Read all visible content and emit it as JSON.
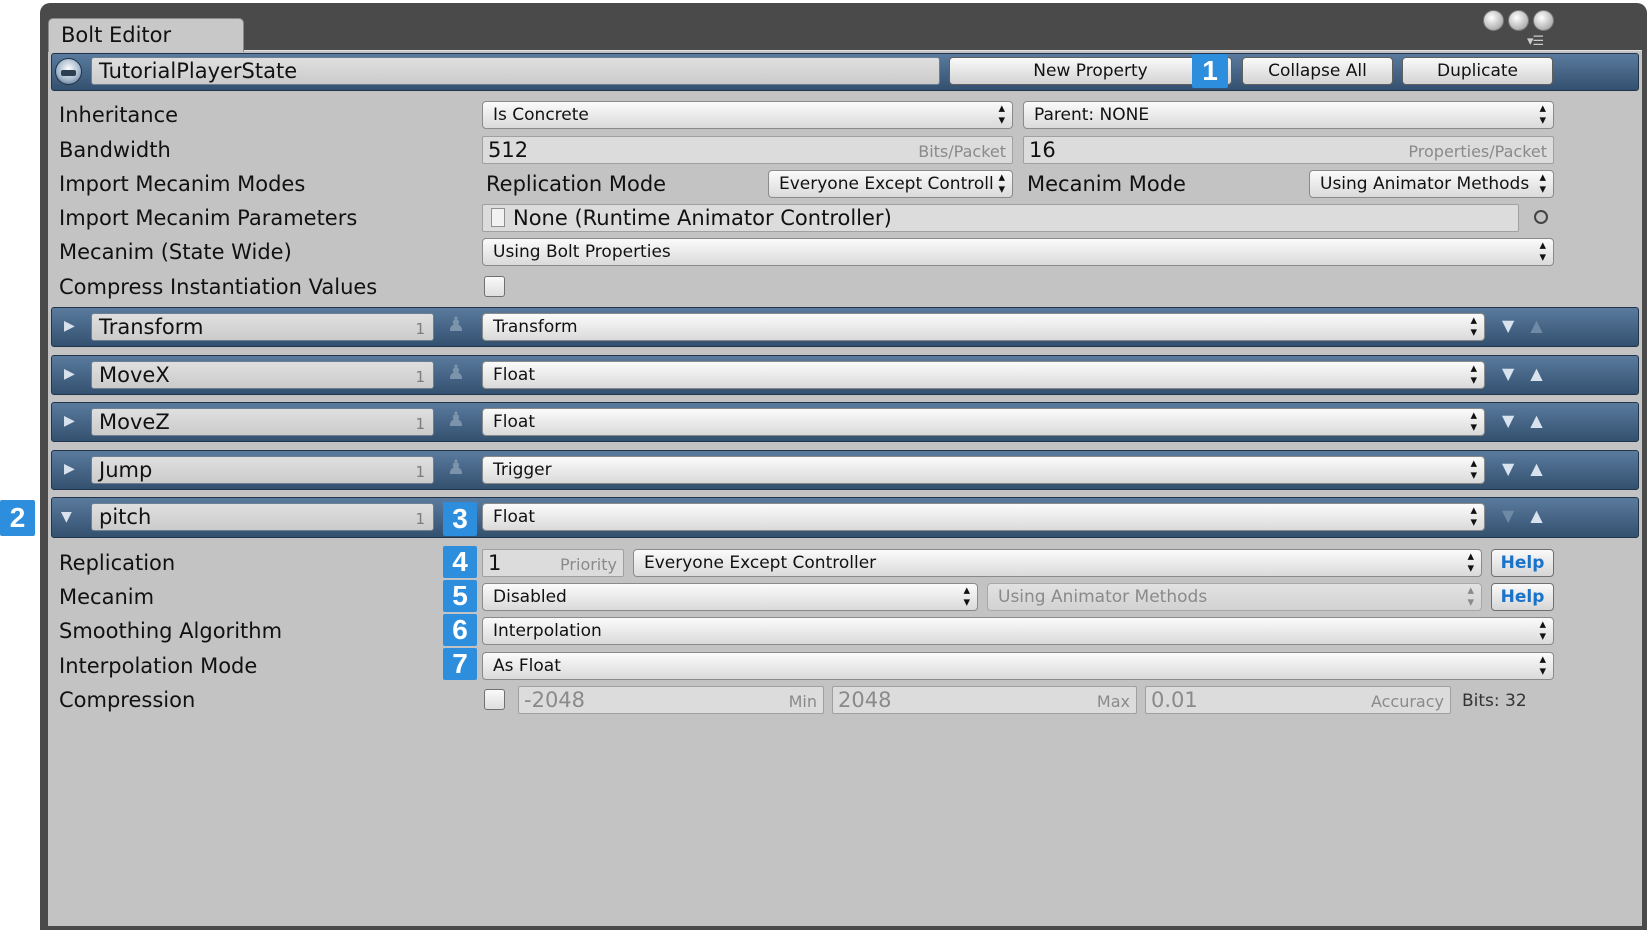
{
  "window": {
    "title": "Bolt Editor"
  },
  "header": {
    "state_name": "TutorialPlayerState",
    "new_property_label": "New Property",
    "collapse_all_label": "Collapse All",
    "duplicate_label": "Duplicate"
  },
  "settings": {
    "inheritance": {
      "label": "Inheritance",
      "type_value": "Is Concrete",
      "parent_value": "Parent: NONE"
    },
    "bandwidth": {
      "label": "Bandwidth",
      "bits_value": "512",
      "bits_unit": "Bits/Packet",
      "props_value": "16",
      "props_unit": "Properties/Packet"
    },
    "import_modes": {
      "label": "Import Mecanim Modes",
      "replication_label": "Replication Mode",
      "replication_value": "Everyone Except Controll",
      "mecanim_label": "Mecanim Mode",
      "mecanim_value": "Using Animator Methods"
    },
    "import_params": {
      "label": "Import Mecanim Parameters",
      "value": "None (Runtime Animator Controller)"
    },
    "state_wide": {
      "label": "Mecanim (State Wide)",
      "value": "Using Bolt Properties"
    },
    "compress": {
      "label": "Compress Instantiation Values"
    }
  },
  "properties": [
    {
      "name": "Transform",
      "count": "1",
      "type": "Transform",
      "expanded": false
    },
    {
      "name": "MoveX",
      "count": "1",
      "type": "Float",
      "expanded": false
    },
    {
      "name": "MoveZ",
      "count": "1",
      "type": "Float",
      "expanded": false
    },
    {
      "name": "Jump",
      "count": "1",
      "type": "Trigger",
      "expanded": false
    },
    {
      "name": "pitch",
      "count": "1",
      "type": "Float",
      "expanded": true
    }
  ],
  "detail": {
    "replication": {
      "label": "Replication",
      "priority_value": "1",
      "priority_unit": "Priority",
      "mode": "Everyone Except Controller",
      "help": "Help"
    },
    "mecanim": {
      "label": "Mecanim",
      "value": "Disabled",
      "method": "Using Animator Methods",
      "help": "Help"
    },
    "smoothing": {
      "label": "Smoothing Algorithm",
      "value": "Interpolation"
    },
    "interp": {
      "label": "Interpolation Mode",
      "value": "As Float"
    },
    "compression": {
      "label": "Compression",
      "min_value": "-2048",
      "min_unit": "Min",
      "max_value": "2048",
      "max_unit": "Max",
      "acc_value": "0.01",
      "acc_unit": "Accuracy",
      "bits": "Bits: 32"
    }
  },
  "badges": [
    "1",
    "2",
    "3",
    "4",
    "5",
    "6",
    "7"
  ],
  "colors": {
    "header_bar": "#4a6c91",
    "badge": "#2e8ede",
    "help_text": "#1a72c9",
    "panel": "#c3c3c3"
  },
  "icons": [
    "bolt-logo-icon",
    "expand-arrow-icon",
    "collapse-arrow-icon",
    "person-icon",
    "move-down-icon",
    "move-up-icon",
    "dropdown-arrows-icon",
    "object-picker-icon",
    "asset-file-icon",
    "window-menu-icon"
  ]
}
